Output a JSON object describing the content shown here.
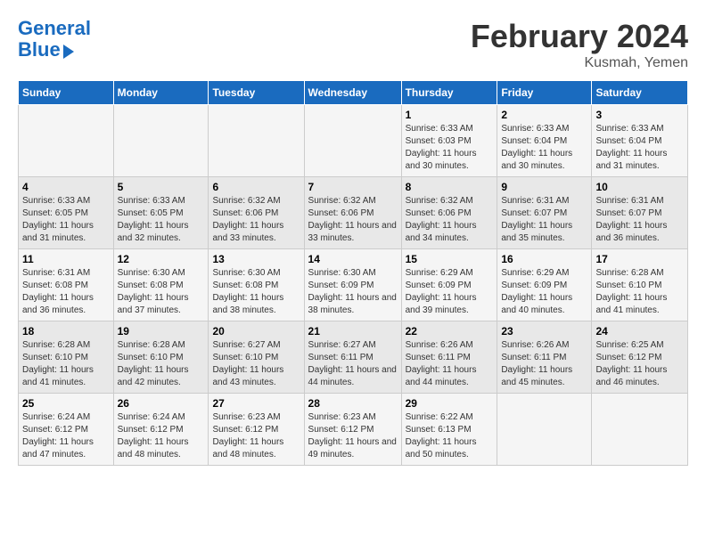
{
  "header": {
    "logo_line1": "General",
    "logo_line2": "Blue",
    "month": "February 2024",
    "location": "Kusmah, Yemen"
  },
  "days_of_week": [
    "Sunday",
    "Monday",
    "Tuesday",
    "Wednesday",
    "Thursday",
    "Friday",
    "Saturday"
  ],
  "weeks": [
    [
      {
        "day": "",
        "info": ""
      },
      {
        "day": "",
        "info": ""
      },
      {
        "day": "",
        "info": ""
      },
      {
        "day": "",
        "info": ""
      },
      {
        "day": "1",
        "info": "Sunrise: 6:33 AM\nSunset: 6:03 PM\nDaylight: 11 hours and 30 minutes."
      },
      {
        "day": "2",
        "info": "Sunrise: 6:33 AM\nSunset: 6:04 PM\nDaylight: 11 hours and 30 minutes."
      },
      {
        "day": "3",
        "info": "Sunrise: 6:33 AM\nSunset: 6:04 PM\nDaylight: 11 hours and 31 minutes."
      }
    ],
    [
      {
        "day": "4",
        "info": "Sunrise: 6:33 AM\nSunset: 6:05 PM\nDaylight: 11 hours and 31 minutes."
      },
      {
        "day": "5",
        "info": "Sunrise: 6:33 AM\nSunset: 6:05 PM\nDaylight: 11 hours and 32 minutes."
      },
      {
        "day": "6",
        "info": "Sunrise: 6:32 AM\nSunset: 6:06 PM\nDaylight: 11 hours and 33 minutes."
      },
      {
        "day": "7",
        "info": "Sunrise: 6:32 AM\nSunset: 6:06 PM\nDaylight: 11 hours and 33 minutes."
      },
      {
        "day": "8",
        "info": "Sunrise: 6:32 AM\nSunset: 6:06 PM\nDaylight: 11 hours and 34 minutes."
      },
      {
        "day": "9",
        "info": "Sunrise: 6:31 AM\nSunset: 6:07 PM\nDaylight: 11 hours and 35 minutes."
      },
      {
        "day": "10",
        "info": "Sunrise: 6:31 AM\nSunset: 6:07 PM\nDaylight: 11 hours and 36 minutes."
      }
    ],
    [
      {
        "day": "11",
        "info": "Sunrise: 6:31 AM\nSunset: 6:08 PM\nDaylight: 11 hours and 36 minutes."
      },
      {
        "day": "12",
        "info": "Sunrise: 6:30 AM\nSunset: 6:08 PM\nDaylight: 11 hours and 37 minutes."
      },
      {
        "day": "13",
        "info": "Sunrise: 6:30 AM\nSunset: 6:08 PM\nDaylight: 11 hours and 38 minutes."
      },
      {
        "day": "14",
        "info": "Sunrise: 6:30 AM\nSunset: 6:09 PM\nDaylight: 11 hours and 38 minutes."
      },
      {
        "day": "15",
        "info": "Sunrise: 6:29 AM\nSunset: 6:09 PM\nDaylight: 11 hours and 39 minutes."
      },
      {
        "day": "16",
        "info": "Sunrise: 6:29 AM\nSunset: 6:09 PM\nDaylight: 11 hours and 40 minutes."
      },
      {
        "day": "17",
        "info": "Sunrise: 6:28 AM\nSunset: 6:10 PM\nDaylight: 11 hours and 41 minutes."
      }
    ],
    [
      {
        "day": "18",
        "info": "Sunrise: 6:28 AM\nSunset: 6:10 PM\nDaylight: 11 hours and 41 minutes."
      },
      {
        "day": "19",
        "info": "Sunrise: 6:28 AM\nSunset: 6:10 PM\nDaylight: 11 hours and 42 minutes."
      },
      {
        "day": "20",
        "info": "Sunrise: 6:27 AM\nSunset: 6:10 PM\nDaylight: 11 hours and 43 minutes."
      },
      {
        "day": "21",
        "info": "Sunrise: 6:27 AM\nSunset: 6:11 PM\nDaylight: 11 hours and 44 minutes."
      },
      {
        "day": "22",
        "info": "Sunrise: 6:26 AM\nSunset: 6:11 PM\nDaylight: 11 hours and 44 minutes."
      },
      {
        "day": "23",
        "info": "Sunrise: 6:26 AM\nSunset: 6:11 PM\nDaylight: 11 hours and 45 minutes."
      },
      {
        "day": "24",
        "info": "Sunrise: 6:25 AM\nSunset: 6:12 PM\nDaylight: 11 hours and 46 minutes."
      }
    ],
    [
      {
        "day": "25",
        "info": "Sunrise: 6:24 AM\nSunset: 6:12 PM\nDaylight: 11 hours and 47 minutes."
      },
      {
        "day": "26",
        "info": "Sunrise: 6:24 AM\nSunset: 6:12 PM\nDaylight: 11 hours and 48 minutes."
      },
      {
        "day": "27",
        "info": "Sunrise: 6:23 AM\nSunset: 6:12 PM\nDaylight: 11 hours and 48 minutes."
      },
      {
        "day": "28",
        "info": "Sunrise: 6:23 AM\nSunset: 6:12 PM\nDaylight: 11 hours and 49 minutes."
      },
      {
        "day": "29",
        "info": "Sunrise: 6:22 AM\nSunset: 6:13 PM\nDaylight: 11 hours and 50 minutes."
      },
      {
        "day": "",
        "info": ""
      },
      {
        "day": "",
        "info": ""
      }
    ]
  ]
}
